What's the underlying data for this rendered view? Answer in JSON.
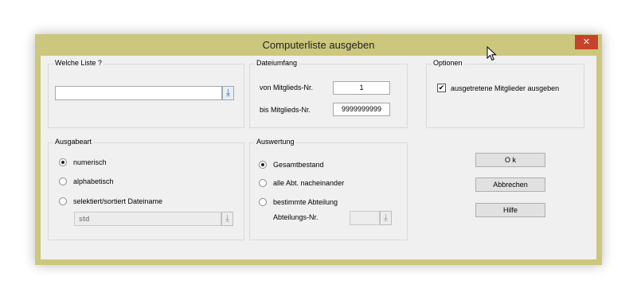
{
  "window": {
    "title": "Computerliste ausgeben",
    "close_glyph": "✕"
  },
  "welche_liste": {
    "legend": "Welche Liste ?",
    "value": ""
  },
  "dateiumfang": {
    "legend": "Dateiumfang",
    "von_label": "von Mitglieds-Nr.",
    "von_value": "1",
    "bis_label": "bis  Mitglieds-Nr.",
    "bis_value": "9999999999"
  },
  "optionen": {
    "legend": "Optionen",
    "checkbox_label": "ausgetretene Mitglieder ausgeben",
    "checked": true
  },
  "ausgabeart": {
    "legend": "Ausgabeart",
    "options": [
      "numerisch",
      "alphabetisch",
      "selektiert/sortiert Dateiname"
    ],
    "selected": "numerisch",
    "filename_value": "std"
  },
  "auswertung": {
    "legend": "Auswertung",
    "options": [
      "Gesamtbestand",
      "alle Abt. nacheinander",
      "bestimmte Abteilung"
    ],
    "selected": "Gesamtbestand",
    "abteilung_label": "Abteilungs-Nr.",
    "abteilung_value": ""
  },
  "buttons": {
    "ok": "O k",
    "cancel": "Abbrechen",
    "help": "Hilfe"
  },
  "icons": {
    "dropdown": "dropdown-arrow-icon",
    "cursor": "mouse-pointer-icon",
    "accent": "#cbc77d",
    "close_color": "#c7422b"
  }
}
